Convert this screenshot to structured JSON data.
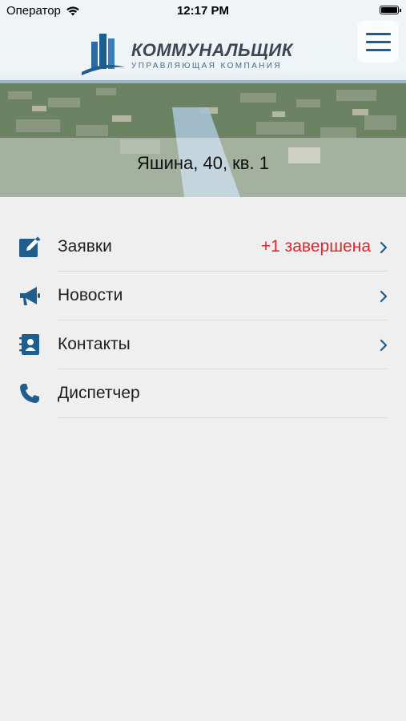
{
  "status_bar": {
    "carrier": "Оператор",
    "time": "12:17 PM"
  },
  "header": {
    "brand_name": "КОММУНАЛЬЩИК",
    "brand_subtitle": "УПРАВЛЯЮЩАЯ КОМПАНИЯ",
    "address": "Яшина, 40, кв. 1"
  },
  "menu": {
    "items": [
      {
        "label": "Заявки",
        "status": "+1 завершена",
        "icon": "edit-icon"
      },
      {
        "label": "Новости",
        "status": "",
        "icon": "megaphone-icon"
      },
      {
        "label": "Контакты",
        "status": "",
        "icon": "contacts-icon"
      },
      {
        "label": "Диспетчер",
        "status": "",
        "icon": "phone-icon"
      }
    ]
  },
  "colors": {
    "accent": "#1f5d8f",
    "alert": "#e0262a",
    "background": "#efefef"
  }
}
